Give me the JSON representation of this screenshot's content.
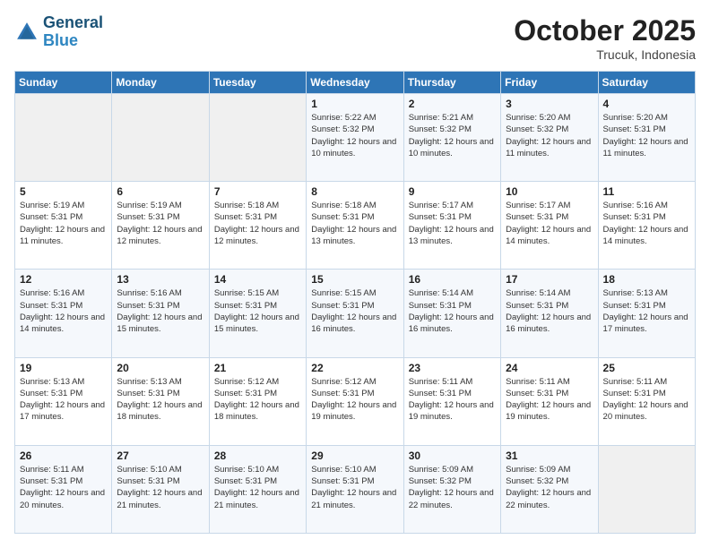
{
  "logo": {
    "line1": "General",
    "line2": "Blue"
  },
  "title": "October 2025",
  "subtitle": "Trucuk, Indonesia",
  "header_days": [
    "Sunday",
    "Monday",
    "Tuesday",
    "Wednesday",
    "Thursday",
    "Friday",
    "Saturday"
  ],
  "weeks": [
    [
      {
        "day": "",
        "info": ""
      },
      {
        "day": "",
        "info": ""
      },
      {
        "day": "",
        "info": ""
      },
      {
        "day": "1",
        "info": "Sunrise: 5:22 AM\nSunset: 5:32 PM\nDaylight: 12 hours\nand 10 minutes."
      },
      {
        "day": "2",
        "info": "Sunrise: 5:21 AM\nSunset: 5:32 PM\nDaylight: 12 hours\nand 10 minutes."
      },
      {
        "day": "3",
        "info": "Sunrise: 5:20 AM\nSunset: 5:32 PM\nDaylight: 12 hours\nand 11 minutes."
      },
      {
        "day": "4",
        "info": "Sunrise: 5:20 AM\nSunset: 5:31 PM\nDaylight: 12 hours\nand 11 minutes."
      }
    ],
    [
      {
        "day": "5",
        "info": "Sunrise: 5:19 AM\nSunset: 5:31 PM\nDaylight: 12 hours\nand 11 minutes."
      },
      {
        "day": "6",
        "info": "Sunrise: 5:19 AM\nSunset: 5:31 PM\nDaylight: 12 hours\nand 12 minutes."
      },
      {
        "day": "7",
        "info": "Sunrise: 5:18 AM\nSunset: 5:31 PM\nDaylight: 12 hours\nand 12 minutes."
      },
      {
        "day": "8",
        "info": "Sunrise: 5:18 AM\nSunset: 5:31 PM\nDaylight: 12 hours\nand 13 minutes."
      },
      {
        "day": "9",
        "info": "Sunrise: 5:17 AM\nSunset: 5:31 PM\nDaylight: 12 hours\nand 13 minutes."
      },
      {
        "day": "10",
        "info": "Sunrise: 5:17 AM\nSunset: 5:31 PM\nDaylight: 12 hours\nand 14 minutes."
      },
      {
        "day": "11",
        "info": "Sunrise: 5:16 AM\nSunset: 5:31 PM\nDaylight: 12 hours\nand 14 minutes."
      }
    ],
    [
      {
        "day": "12",
        "info": "Sunrise: 5:16 AM\nSunset: 5:31 PM\nDaylight: 12 hours\nand 14 minutes."
      },
      {
        "day": "13",
        "info": "Sunrise: 5:16 AM\nSunset: 5:31 PM\nDaylight: 12 hours\nand 15 minutes."
      },
      {
        "day": "14",
        "info": "Sunrise: 5:15 AM\nSunset: 5:31 PM\nDaylight: 12 hours\nand 15 minutes."
      },
      {
        "day": "15",
        "info": "Sunrise: 5:15 AM\nSunset: 5:31 PM\nDaylight: 12 hours\nand 16 minutes."
      },
      {
        "day": "16",
        "info": "Sunrise: 5:14 AM\nSunset: 5:31 PM\nDaylight: 12 hours\nand 16 minutes."
      },
      {
        "day": "17",
        "info": "Sunrise: 5:14 AM\nSunset: 5:31 PM\nDaylight: 12 hours\nand 16 minutes."
      },
      {
        "day": "18",
        "info": "Sunrise: 5:13 AM\nSunset: 5:31 PM\nDaylight: 12 hours\nand 17 minutes."
      }
    ],
    [
      {
        "day": "19",
        "info": "Sunrise: 5:13 AM\nSunset: 5:31 PM\nDaylight: 12 hours\nand 17 minutes."
      },
      {
        "day": "20",
        "info": "Sunrise: 5:13 AM\nSunset: 5:31 PM\nDaylight: 12 hours\nand 18 minutes."
      },
      {
        "day": "21",
        "info": "Sunrise: 5:12 AM\nSunset: 5:31 PM\nDaylight: 12 hours\nand 18 minutes."
      },
      {
        "day": "22",
        "info": "Sunrise: 5:12 AM\nSunset: 5:31 PM\nDaylight: 12 hours\nand 19 minutes."
      },
      {
        "day": "23",
        "info": "Sunrise: 5:11 AM\nSunset: 5:31 PM\nDaylight: 12 hours\nand 19 minutes."
      },
      {
        "day": "24",
        "info": "Sunrise: 5:11 AM\nSunset: 5:31 PM\nDaylight: 12 hours\nand 19 minutes."
      },
      {
        "day": "25",
        "info": "Sunrise: 5:11 AM\nSunset: 5:31 PM\nDaylight: 12 hours\nand 20 minutes."
      }
    ],
    [
      {
        "day": "26",
        "info": "Sunrise: 5:11 AM\nSunset: 5:31 PM\nDaylight: 12 hours\nand 20 minutes."
      },
      {
        "day": "27",
        "info": "Sunrise: 5:10 AM\nSunset: 5:31 PM\nDaylight: 12 hours\nand 21 minutes."
      },
      {
        "day": "28",
        "info": "Sunrise: 5:10 AM\nSunset: 5:31 PM\nDaylight: 12 hours\nand 21 minutes."
      },
      {
        "day": "29",
        "info": "Sunrise: 5:10 AM\nSunset: 5:31 PM\nDaylight: 12 hours\nand 21 minutes."
      },
      {
        "day": "30",
        "info": "Sunrise: 5:09 AM\nSunset: 5:32 PM\nDaylight: 12 hours\nand 22 minutes."
      },
      {
        "day": "31",
        "info": "Sunrise: 5:09 AM\nSunset: 5:32 PM\nDaylight: 12 hours\nand 22 minutes."
      },
      {
        "day": "",
        "info": ""
      }
    ]
  ]
}
